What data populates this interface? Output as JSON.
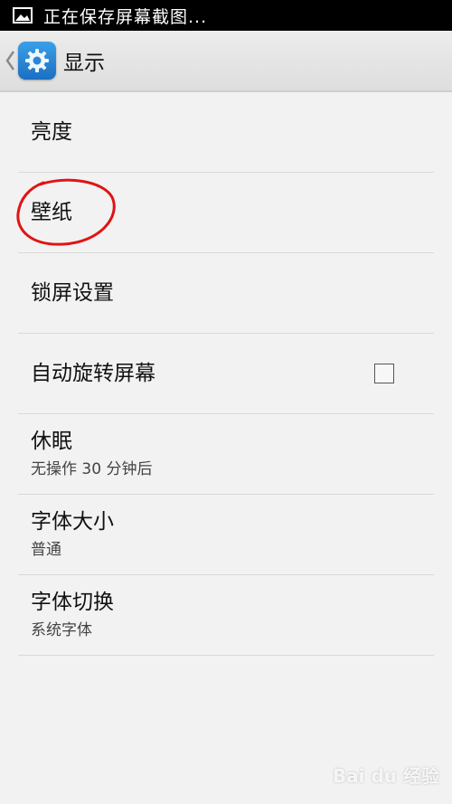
{
  "status_bar": {
    "notification_text": "正在保存屏幕截图...",
    "icon": "image-icon"
  },
  "action_bar": {
    "title": "显示",
    "back_icon": "chevron-left-icon",
    "app_icon": "gear-icon"
  },
  "settings": [
    {
      "title": "亮度",
      "subtitle": ""
    },
    {
      "title": "壁纸",
      "subtitle": ""
    },
    {
      "title": "锁屏设置",
      "subtitle": ""
    },
    {
      "title": "自动旋转屏幕",
      "subtitle": "",
      "checkbox": {
        "checked": false
      }
    },
    {
      "title": "休眠",
      "subtitle": "无操作 30 分钟后"
    },
    {
      "title": "字体大小",
      "subtitle": "普通"
    },
    {
      "title": "字体切换",
      "subtitle": "系统字体"
    }
  ],
  "annotation": {
    "color": "#e01414",
    "target": "壁纸"
  },
  "watermark": "Bai du 经验"
}
